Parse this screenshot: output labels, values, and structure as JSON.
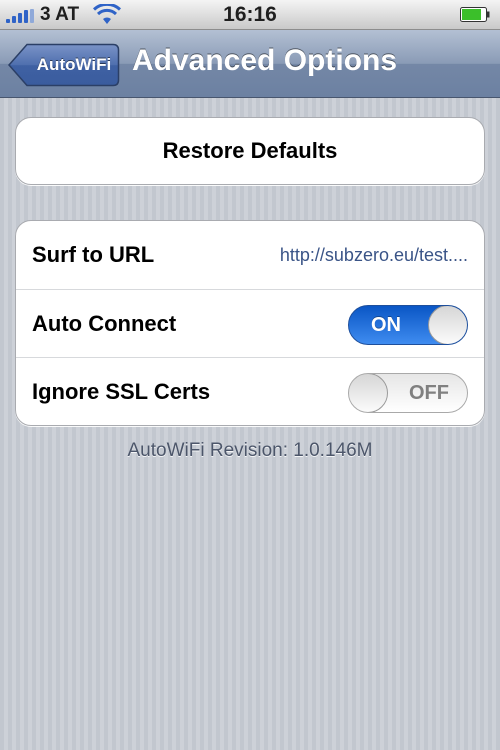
{
  "status_bar": {
    "carrier": "3 AT",
    "time": "16:16",
    "icons": [
      "signal-icon",
      "wifi-icon",
      "battery-icon"
    ],
    "battery_level": 0.8
  },
  "nav_bar": {
    "back_label": "AutoWiFi",
    "title": "Advanced Options"
  },
  "restore": {
    "label": "Restore Defaults"
  },
  "settings": {
    "rows": [
      {
        "label": "Surf to URL",
        "value": "http://subzero.eu/test...."
      },
      {
        "label": "Auto Connect",
        "switch_state": "ON"
      },
      {
        "label": "Ignore SSL Certs",
        "switch_state": "OFF"
      }
    ]
  },
  "footer": {
    "revision": "AutoWiFi Revision: 1.0.146M"
  },
  "colors": {
    "nav_bar": "#7487a6",
    "switch_on": "#2f7be0",
    "link_value": "#3a5487"
  }
}
